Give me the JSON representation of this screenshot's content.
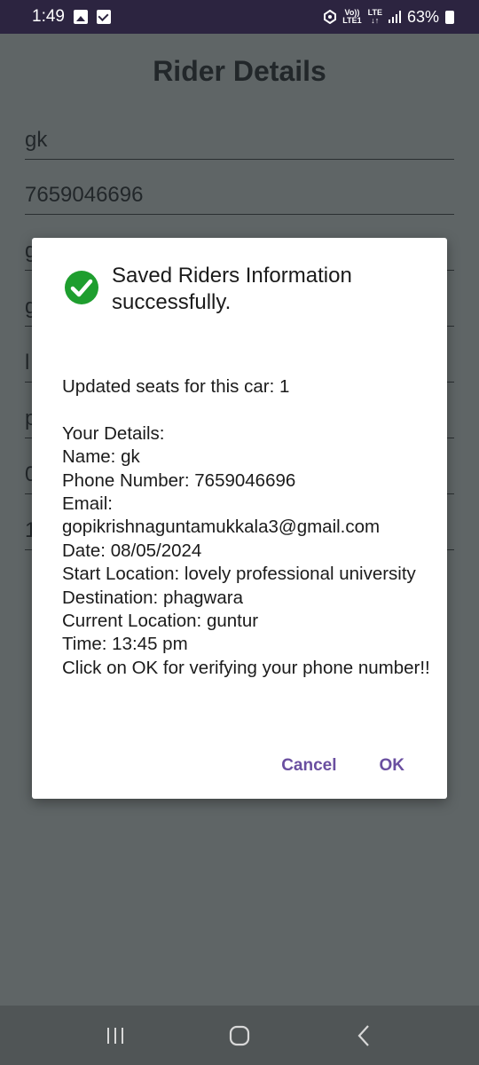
{
  "status_bar": {
    "time": "1:49",
    "volte_top": "Vo))",
    "volte_bottom": "LTE1",
    "lte_top": "LTE",
    "lte_bottom": "↓↑",
    "battery": "63%"
  },
  "screen": {
    "title": "Rider Details",
    "fields": [
      {
        "value": "gk"
      },
      {
        "value": "7659046696"
      },
      {
        "value": "g"
      },
      {
        "value": "g"
      },
      {
        "value": "l"
      },
      {
        "value": "p"
      },
      {
        "value": "0"
      },
      {
        "value": "1"
      }
    ]
  },
  "dialog": {
    "title": "Saved Riders Information successfully.",
    "updated_seats": "Updated seats for this car: 1",
    "your_details": "Your Details:",
    "name": "Name: gk",
    "phone": "Phone Number: 7659046696",
    "email_label": "Email:",
    "email_value": "gopikrishnaguntamukkala3@gmail.com",
    "date": "Date: 08/05/2024",
    "start": "Start Location: lovely professional university",
    "destination": "Destination: phagwara",
    "current": "Current Location: guntur",
    "time": "Time: 13:45 pm",
    "verify": "Click on OK for verifying your phone number!!",
    "cancel_label": "Cancel",
    "ok_label": "OK"
  },
  "colors": {
    "accent": "#6a4fa0",
    "success": "#1e9e2e",
    "scrim": "#5f6566",
    "status_bar": "#2c2440"
  }
}
